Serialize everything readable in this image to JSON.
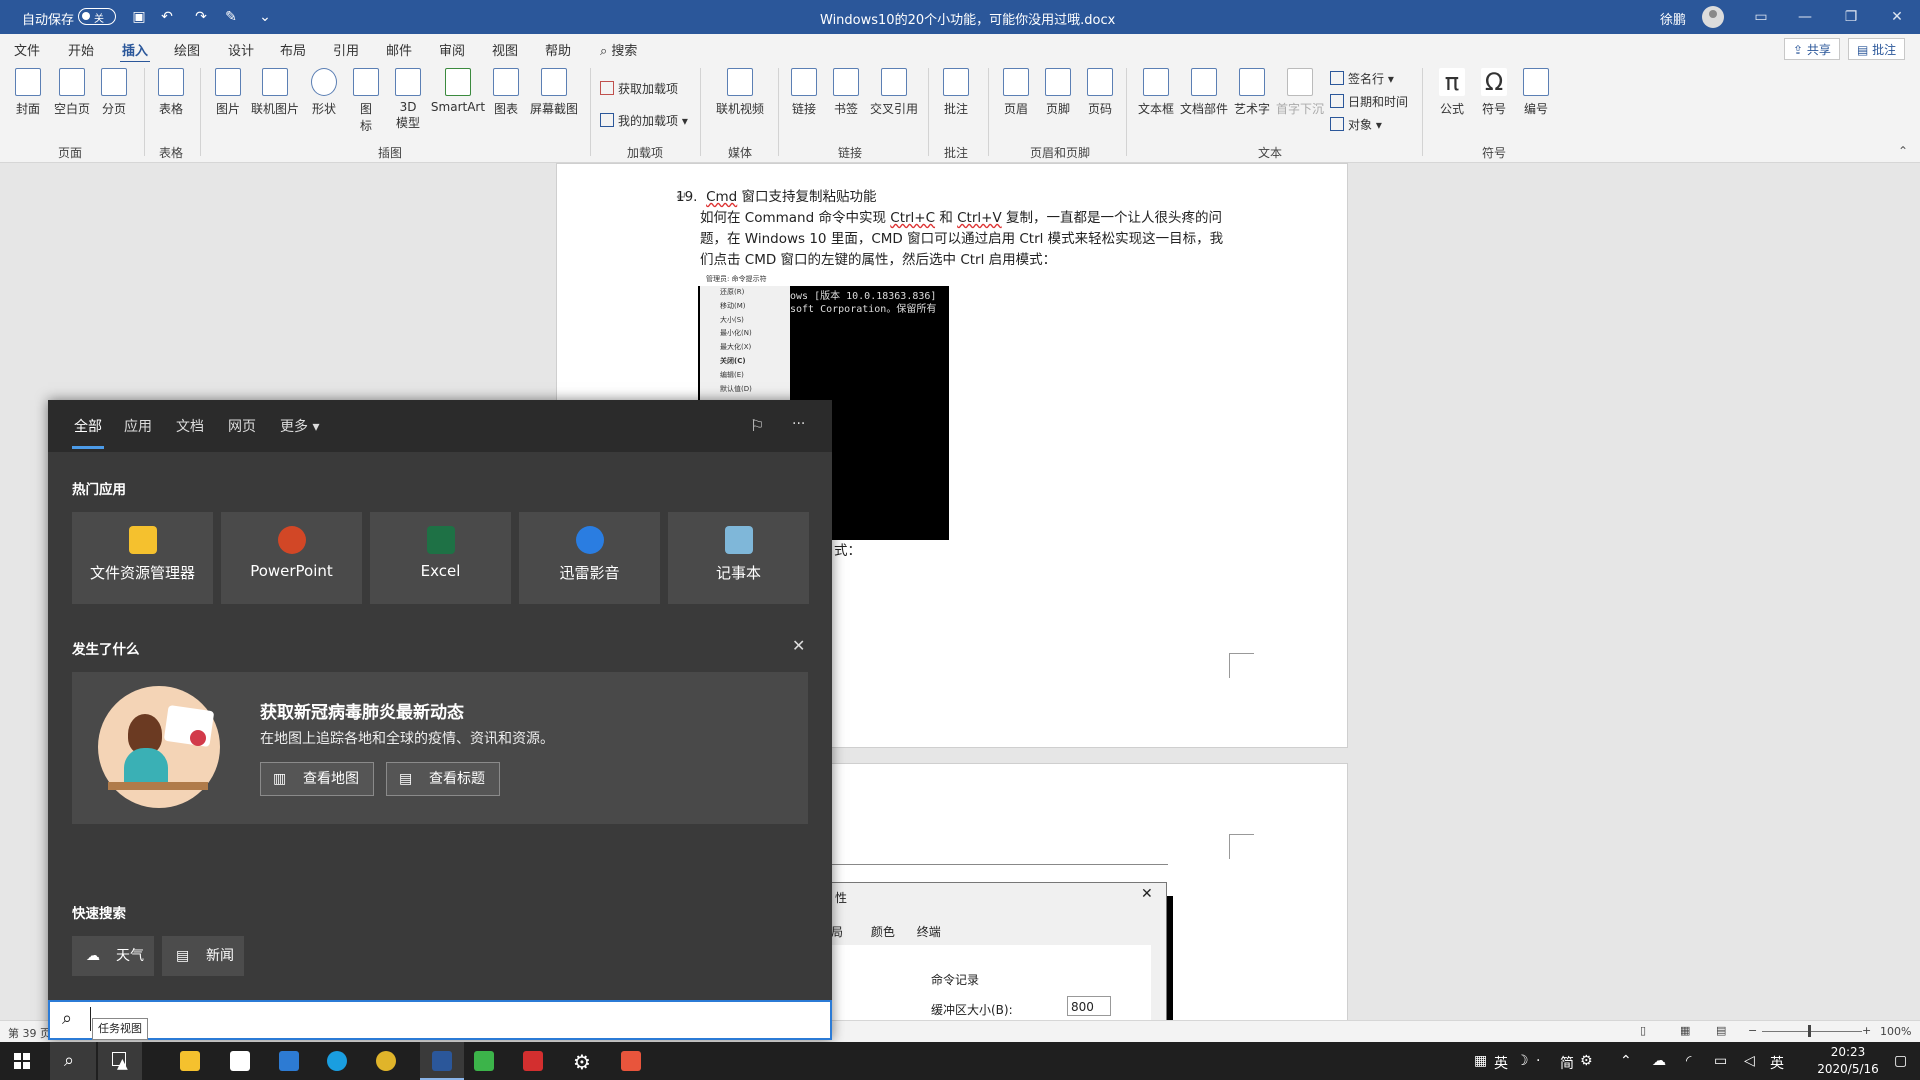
{
  "titlebar": {
    "autosave_label": "自动保存",
    "autosave_state": "关",
    "doc_title": "Windows10的20个小功能，可能你没用过哦.docx",
    "user_name": "徐鹏"
  },
  "tabs": [
    "文件",
    "开始",
    "插入",
    "绘图",
    "设计",
    "布局",
    "引用",
    "邮件",
    "审阅",
    "视图",
    "帮助"
  ],
  "active_tab": "插入",
  "tell_me": "搜索",
  "share_label": "共享",
  "comment_label": "批注",
  "ribbon": {
    "buttons": {
      "cover": "封面",
      "blank": "空白页",
      "pagebreak": "分页",
      "table": "表格",
      "picture": "图片",
      "online_picture": "联机图片",
      "shapes": "形状",
      "icons": "图\n标",
      "model3d": "3D\n模型",
      "smartart": "SmartArt",
      "chart": "图表",
      "screenshot": "屏幕截图",
      "get_addins": "获取加载项",
      "my_addins": "我的加载项",
      "online_video": "联机视频",
      "link": "链接",
      "bookmark": "书签",
      "crossref": "交叉引用",
      "comment": "批注",
      "header": "页眉",
      "footer": "页脚",
      "pagenum": "页码",
      "textbox": "文本框",
      "quickparts": "文档部件",
      "wordart": "艺术字",
      "dropcap": "首字下沉",
      "signature": "签名行",
      "datetime": "日期和时间",
      "object": "对象",
      "equation": "公式",
      "symbol": "符号",
      "number": "编号"
    },
    "groups": {
      "pages": "页面",
      "tables": "表格",
      "illustrations": "插图",
      "addins": "加载项",
      "media": "媒体",
      "links": "链接",
      "comments": "批注",
      "header_footer": "页眉和页脚",
      "text": "文本",
      "symbols": "符号"
    }
  },
  "document": {
    "item_number": "19.",
    "item_title_1": "Cmd",
    "item_title_2": " 窗口支持复制粘贴功能",
    "para_line1_a": "如何在 Command 命令中实现 ",
    "para_line1_ctrlc": "Ctrl+C",
    "para_line1_b": " 和 ",
    "para_line1_ctrlv": "Ctrl+V",
    "para_line1_c": " 复制，一直都是一个让人很头疼的问",
    "para_line2": "题，在 Windows 10 里面，CMD 窗口可以通过启用 Ctrl 模式来轻松实现这一目标，我",
    "para_line3": "们点击 CMD 窗口的左键的属性，然后选中 Ctrl 启用模式：",
    "after_image": "式：",
    "cmd_title": "管理员: 命令提示符",
    "cmd_lines": [
      "ows [版本 10.0.18363.836]",
      "soft Corporation。保留所有"
    ],
    "cmd_menu": [
      "还原(R)",
      "移动(M)",
      "大小(S)",
      "最小化(N)",
      "最大化(X)",
      "关闭(C)",
      "编辑(E)",
      "默认值(D)"
    ],
    "dialog_title": "性",
    "dialog_tabs": [
      "局",
      "颜色",
      "终端"
    ],
    "dialog_section": "命令记录",
    "dialog_field_label": "缓冲区大小(B):",
    "dialog_field_value": "800"
  },
  "status": {
    "page_info": "第 39 页",
    "zoom": "100%"
  },
  "search_panel": {
    "tabs": [
      "全部",
      "应用",
      "文档",
      "网页",
      "更多"
    ],
    "active_tab": "全部",
    "hot_apps_title": "热门应用",
    "hot_apps": [
      {
        "name": "文件资源管理器",
        "color": "#f5c12e"
      },
      {
        "name": "PowerPoint",
        "color": "#d24726"
      },
      {
        "name": "Excel",
        "color": "#1e7145"
      },
      {
        "name": "迅雷影音",
        "color": "#2a7de1"
      },
      {
        "name": "记事本",
        "color": "#7fb7d9"
      }
    ],
    "news_section_title": "发生了什么",
    "news_title": "获取新冠病毒肺炎最新动态",
    "news_desc": "在地图上追踪各地和全球的疫情、资讯和资源。",
    "news_btn_map": "查看地图",
    "news_btn_headlines": "查看标题",
    "quick_title": "快速搜索",
    "quick_items": [
      "天气",
      "新闻"
    ],
    "tooltip": "任务视图"
  },
  "taskbar": {
    "tray_items": [
      "英",
      "简"
    ],
    "ime_label": "英",
    "time": "20:23",
    "date": "2020/5/16"
  },
  "colors": {
    "word_blue": "#2b579a",
    "search_bg": "#3a3a3a",
    "accent": "#4c9be8"
  }
}
